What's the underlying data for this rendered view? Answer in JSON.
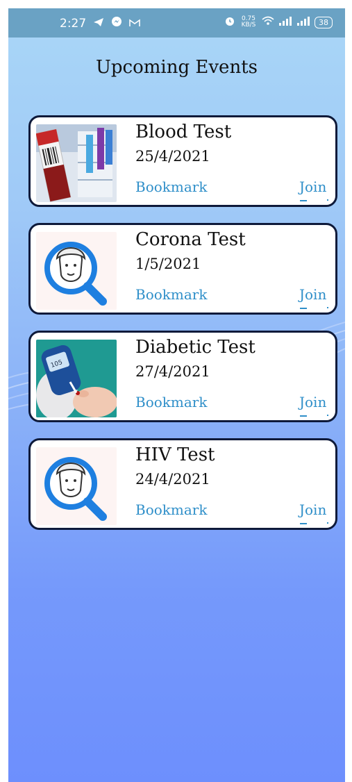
{
  "statusbar": {
    "time": "2:27",
    "data_speed": "0.75 KB/S",
    "battery": "38"
  },
  "page": {
    "title": "Upcoming Events"
  },
  "events": [
    {
      "name": "Blood Test",
      "date": "25/4/2021",
      "bookmark_label": "Bookmark",
      "join_label": "Join",
      "image": "blood-test-tubes-photo"
    },
    {
      "name": "Corona Test",
      "date": "1/5/2021",
      "bookmark_label": "Bookmark",
      "join_label": "Join",
      "image": "magnifier-doctor-icon"
    },
    {
      "name": "Diabetic Test",
      "date": "27/4/2021",
      "bookmark_label": "Bookmark",
      "join_label": "Join",
      "image": "glucose-meter-photo"
    },
    {
      "name": "HIV Test",
      "date": "24/4/2021",
      "bookmark_label": "Bookmark",
      "join_label": "Join",
      "image": "magnifier-doctor-icon"
    }
  ],
  "glucose_reading": "105",
  "colors": {
    "accent": "#2f8fc9",
    "card_border": "#0e1a3a",
    "statusbar": "#6aa2c4"
  }
}
